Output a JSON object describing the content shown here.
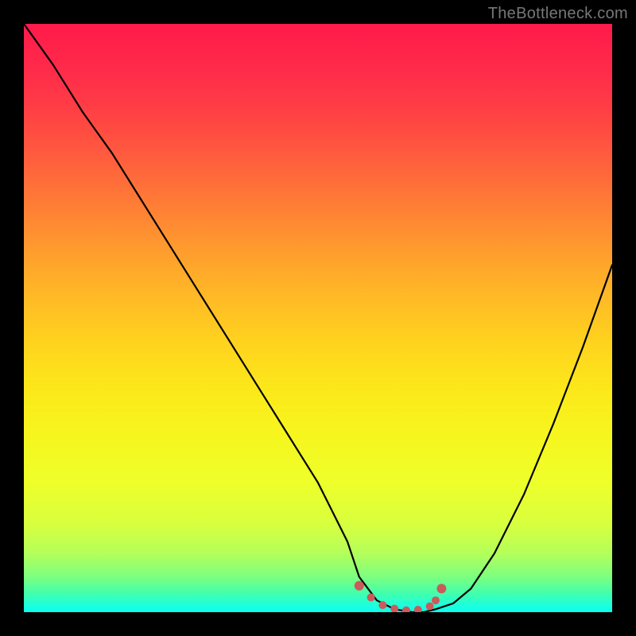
{
  "watermark": {
    "text": "TheBottleneck.com"
  },
  "chart_data": {
    "type": "line",
    "title": "",
    "xlabel": "",
    "ylabel": "",
    "xlim": [
      0,
      100
    ],
    "ylim": [
      0,
      100
    ],
    "series": [
      {
        "name": "curve",
        "x": [
          0,
          5,
          10,
          15,
          20,
          25,
          30,
          35,
          40,
          45,
          50,
          55,
          57,
          60,
          63,
          66,
          68,
          70,
          73,
          76,
          80,
          85,
          90,
          95,
          100
        ],
        "values": [
          100,
          93,
          85,
          78,
          70,
          62,
          54,
          46,
          38,
          30,
          22,
          12,
          6,
          2,
          0.5,
          0,
          0,
          0.5,
          1.5,
          4,
          10,
          20,
          32,
          45,
          59
        ]
      }
    ],
    "markers": {
      "name": "highlight-dots",
      "color": "#cc5a5a",
      "x": [
        57,
        59,
        61,
        63,
        65,
        67,
        69,
        70,
        71
      ],
      "values": [
        4.5,
        2.5,
        1.2,
        0.6,
        0.3,
        0.4,
        1.0,
        2.0,
        4.0
      ]
    },
    "gradient_stops": [
      {
        "pos": 0,
        "color": "#ff1a4a"
      },
      {
        "pos": 50,
        "color": "#ffd21e"
      },
      {
        "pos": 80,
        "color": "#eeff2a"
      },
      {
        "pos": 100,
        "color": "#1affe0"
      }
    ]
  }
}
